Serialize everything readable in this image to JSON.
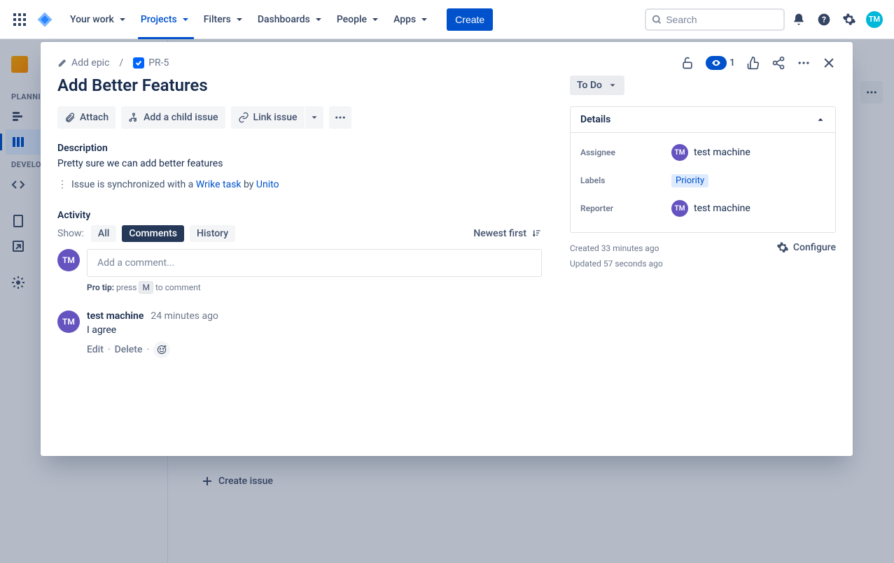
{
  "nav": {
    "your_work": "Your work",
    "projects": "Projects",
    "filters": "Filters",
    "dashboards": "Dashboards",
    "people": "People",
    "apps": "Apps",
    "create": "Create",
    "search_placeholder": "Search"
  },
  "sidebar": {
    "planning": "PLANNING",
    "development": "DEVELOPMENT"
  },
  "bg": {
    "create_issue": "Create issue"
  },
  "breadcrumb": {
    "add_epic": "Add epic",
    "issue_key": "PR-5"
  },
  "issue": {
    "title": "Add Better Features"
  },
  "toolbar": {
    "attach": "Attach",
    "add_child": "Add a child issue",
    "link_issue": "Link issue"
  },
  "description": {
    "label": "Description",
    "text": "Pretty sure we can add better features",
    "sync_prefix": "Issue is synchronized with a ",
    "sync_link": "Wrike task",
    "sync_by": " by ",
    "sync_app": "Unito"
  },
  "activity": {
    "label": "Activity",
    "show": "Show:",
    "all": "All",
    "comments": "Comments",
    "history": "History",
    "newest_first": "Newest first",
    "comment_placeholder": "Add a comment...",
    "protip_label": "Pro tip:",
    "protip_press": " press ",
    "protip_key": "M",
    "protip_rest": " to comment"
  },
  "comment": {
    "author": "test machine",
    "time": "24 minutes ago",
    "text": "I agree",
    "edit": "Edit",
    "delete": "Delete"
  },
  "header_actions": {
    "watch_count": "1"
  },
  "status": {
    "label": "To Do"
  },
  "details": {
    "title": "Details",
    "assignee_k": "Assignee",
    "assignee_v": "test machine",
    "labels_k": "Labels",
    "labels_v": "Priority",
    "reporter_k": "Reporter",
    "reporter_v": "test machine"
  },
  "timestamps": {
    "created": "Created 33 minutes ago",
    "updated": "Updated 57 seconds ago",
    "configure": "Configure"
  },
  "avatar_initials": "TM"
}
